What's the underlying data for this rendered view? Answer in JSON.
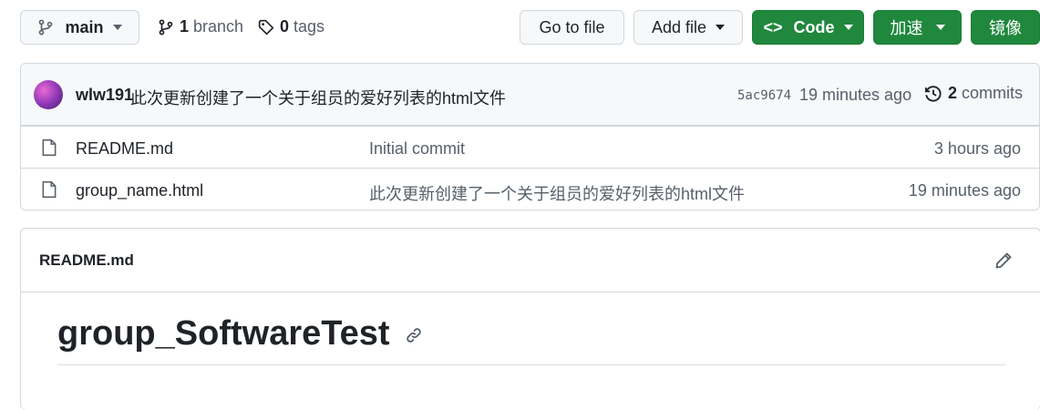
{
  "toolbar": {
    "branch_button": "main",
    "branch_count": "1",
    "branch_label": "branch",
    "tag_count": "0",
    "tag_label": "tags",
    "go_to_file": "Go to file",
    "add_file": "Add file",
    "code": "Code",
    "accelerate": "加速",
    "mirror": "镜像"
  },
  "latest_commit": {
    "author": "wlw191",
    "message": "此次更新创建了一个关于组员的爱好列表的html文件",
    "sha": "5ac9674",
    "time": "19 minutes ago",
    "commit_count": "2",
    "commit_label": "commits"
  },
  "files": [
    {
      "name": "README.md",
      "message": "Initial commit",
      "time": "3 hours ago"
    },
    {
      "name": "group_name.html",
      "message": "此次更新创建了一个关于组员的爱好列表的html文件",
      "time": "19 minutes ago"
    }
  ],
  "readme": {
    "filename": "README.md",
    "heading": "group_SoftwareTest"
  },
  "colors": {
    "accent_green": "#1f883d",
    "border": "#d0d7de",
    "muted_text": "#57606a"
  }
}
